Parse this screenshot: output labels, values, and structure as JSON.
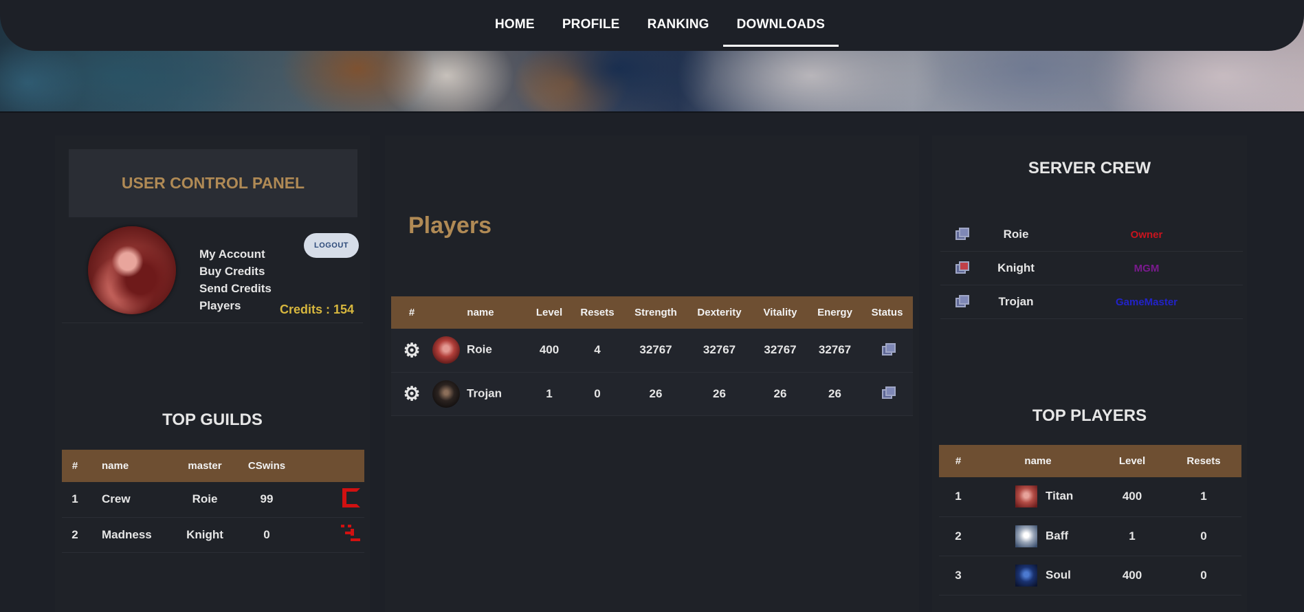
{
  "nav": {
    "items": [
      "HOME",
      "PROFILE",
      "RANKING",
      "DOWNLOADS"
    ],
    "active": "DOWNLOADS"
  },
  "user_panel": {
    "title": "USER CONTROL PANEL",
    "links": [
      "My Account",
      "Buy Credits",
      "Send Credits",
      "Players"
    ],
    "logout_label": "LOGOUT",
    "credits_text": "Credits : 154"
  },
  "top_guilds": {
    "title": "TOP GUILDS",
    "columns": [
      "#",
      "name",
      "master",
      "CSwins"
    ],
    "rows": [
      {
        "rank": "1",
        "name": "Crew",
        "master": "Roie",
        "cswins": "99",
        "logo": "crew-guild-logo"
      },
      {
        "rank": "2",
        "name": "Madness",
        "master": "Knight",
        "cswins": "0",
        "logo": "madness-guild-logo"
      }
    ]
  },
  "players": {
    "title": "Players",
    "columns": [
      "#",
      "name",
      "Level",
      "Resets",
      "Strength",
      "Dexterity",
      "Vitality",
      "Energy",
      "Status"
    ],
    "rows": [
      {
        "name": "Roie",
        "level": "400",
        "resets": "4",
        "strength": "32767",
        "dexterity": "32767",
        "vitality": "32767",
        "energy": "32767",
        "status_icon": "online-status-icon"
      },
      {
        "name": "Trojan",
        "level": "1",
        "resets": "0",
        "strength": "26",
        "dexterity": "26",
        "vitality": "26",
        "energy": "26",
        "status_icon": "online-status-icon"
      }
    ]
  },
  "server_crew": {
    "title": "SERVER CREW",
    "rows": [
      {
        "name": "Roie",
        "role": "Owner",
        "role_color": "#c8141e"
      },
      {
        "name": "Knight",
        "role": "MGM",
        "role_color": "#7a1a8e"
      },
      {
        "name": "Trojan",
        "role": "GameMaster",
        "role_color": "#2222c8"
      }
    ]
  },
  "top_players": {
    "title": "TOP PLAYERS",
    "columns": [
      "#",
      "name",
      "Level",
      "Resets"
    ],
    "rows": [
      {
        "rank": "1",
        "name": "Titan",
        "level": "400",
        "resets": "1"
      },
      {
        "rank": "2",
        "name": "Baff",
        "level": "1",
        "resets": "0"
      },
      {
        "rank": "3",
        "name": "Soul",
        "level": "400",
        "resets": "0"
      }
    ]
  },
  "colors": {
    "accent_gold": "#b08a55",
    "table_header": "#6e4f32",
    "credits": "#d7b73e"
  }
}
